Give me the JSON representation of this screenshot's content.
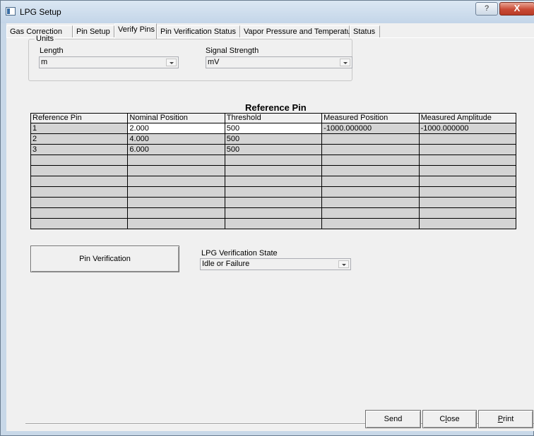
{
  "window": {
    "title": "LPG Setup",
    "help_label": "?",
    "close_label": "X"
  },
  "tabs": [
    {
      "label": "Gas Correction"
    },
    {
      "label": "Pin Setup"
    },
    {
      "label": "Verify Pins"
    },
    {
      "label": "Pin Verification Status"
    },
    {
      "label": "Vapor Pressure and Temperature"
    },
    {
      "label": "Status"
    }
  ],
  "units": {
    "legend": "Units",
    "length_label": "Length",
    "length_value": "m",
    "signal_label": "Signal Strength",
    "signal_value": "mV"
  },
  "table": {
    "title": "Reference Pin",
    "headers": [
      "Reference Pin",
      "Nominal Position",
      "Threshold",
      "Measured Position",
      "Measured Amplitude"
    ],
    "rows": [
      [
        "1",
        "2.000",
        "500",
        "-1000.000000",
        "-1000.000000"
      ],
      [
        "2",
        "4.000",
        "500",
        "",
        ""
      ],
      [
        "3",
        "6.000",
        "500",
        "",
        ""
      ],
      [
        "",
        "",
        "",
        "",
        ""
      ],
      [
        "",
        "",
        "",
        "",
        ""
      ],
      [
        "",
        "",
        "",
        "",
        ""
      ],
      [
        "",
        "",
        "",
        "",
        ""
      ],
      [
        "",
        "",
        "",
        "",
        ""
      ],
      [
        "",
        "",
        "",
        "",
        ""
      ],
      [
        "",
        "",
        "",
        "",
        ""
      ]
    ]
  },
  "verification": {
    "button_label": "Pin Verification",
    "state_label": "LPG Verification State",
    "state_value": "Idle or Failure"
  },
  "footer": {
    "send_label": "Send",
    "close_label_pre": "C",
    "close_label_accel": "l",
    "close_label_post": "ose",
    "print_label_accel": "P",
    "print_label_post": "rint"
  }
}
